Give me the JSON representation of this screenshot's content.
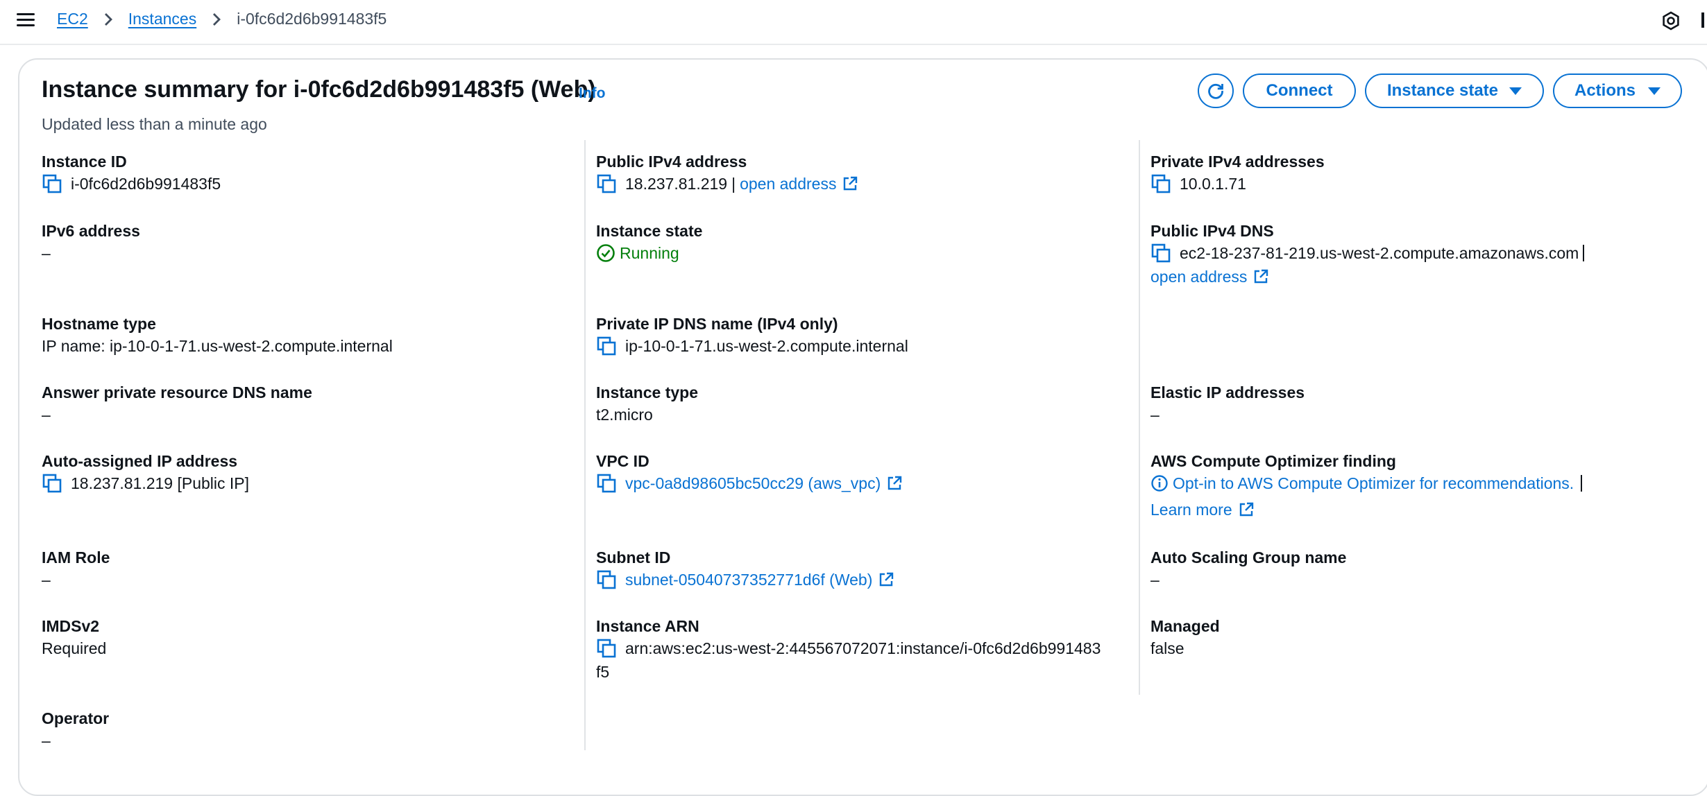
{
  "breadcrumb": {
    "root": "EC2",
    "parent": "Instances",
    "current": "i-0fc6d2d6b991483f5"
  },
  "header": {
    "title": "Instance summary for i-0fc6d2d6b991483f5 (Web)",
    "info": "Info",
    "updated": "Updated less than a minute ago"
  },
  "buttons": {
    "connect": "Connect",
    "instance_state": "Instance state",
    "actions": "Actions"
  },
  "fields": {
    "instance_id": {
      "label": "Instance ID",
      "value": "i-0fc6d2d6b991483f5"
    },
    "public_ipv4": {
      "label": "Public IPv4 address",
      "value": "18.237.81.219",
      "sep": "|",
      "link": "open address"
    },
    "private_ipv4": {
      "label": "Private IPv4 addresses",
      "value": "10.0.1.71"
    },
    "ipv6": {
      "label": "IPv6 address",
      "value": "–"
    },
    "instance_state": {
      "label": "Instance state",
      "value": "Running"
    },
    "public_dns": {
      "label": "Public IPv4 DNS",
      "value": "ec2-18-237-81-219.us-west-2.compute.amazonaws.com",
      "link": "open address"
    },
    "hostname_type": {
      "label": "Hostname type",
      "value": "IP name: ip-10-0-1-71.us-west-2.compute.internal"
    },
    "private_dns": {
      "label": "Private IP DNS name (IPv4 only)",
      "value": "ip-10-0-1-71.us-west-2.compute.internal"
    },
    "answer_dns": {
      "label": "Answer private resource DNS name",
      "value": "–"
    },
    "instance_type": {
      "label": "Instance type",
      "value": "t2.micro"
    },
    "elastic_ip": {
      "label": "Elastic IP addresses",
      "value": "–"
    },
    "auto_ip": {
      "label": "Auto-assigned IP address",
      "value": "18.237.81.219 [Public IP]"
    },
    "vpc_id": {
      "label": "VPC ID",
      "value": "vpc-0a8d98605bc50cc29 (aws_vpc)"
    },
    "optimizer": {
      "label": "AWS Compute Optimizer finding",
      "value": "Opt-in to AWS Compute Optimizer for recommendations.",
      "link": "Learn more"
    },
    "iam_role": {
      "label": "IAM Role",
      "value": "–"
    },
    "subnet_id": {
      "label": "Subnet ID",
      "value": "subnet-05040737352771d6f (Web)"
    },
    "asg_name": {
      "label": "Auto Scaling Group name",
      "value": "–"
    },
    "imdsv2": {
      "label": "IMDSv2",
      "value": "Required"
    },
    "instance_arn": {
      "label": "Instance ARN",
      "value_line1": "arn:aws:ec2:us-west-2:445567072071:instance/i-0fc6d2d6b991483",
      "value_line2": "f5"
    },
    "managed": {
      "label": "Managed",
      "value": "false"
    },
    "operator": {
      "label": "Operator",
      "value": "–"
    }
  },
  "colors": {
    "link": "#0972d3",
    "success": "#037f0c",
    "text": "#0f141a",
    "muted": "#414d5c"
  },
  "icons": [
    "menu-icon",
    "chevron-right-icon",
    "notifications-icon",
    "refresh-icon",
    "caret-down-icon",
    "copy-icon",
    "external-link-icon",
    "status-success-icon",
    "info-circle-icon"
  ]
}
